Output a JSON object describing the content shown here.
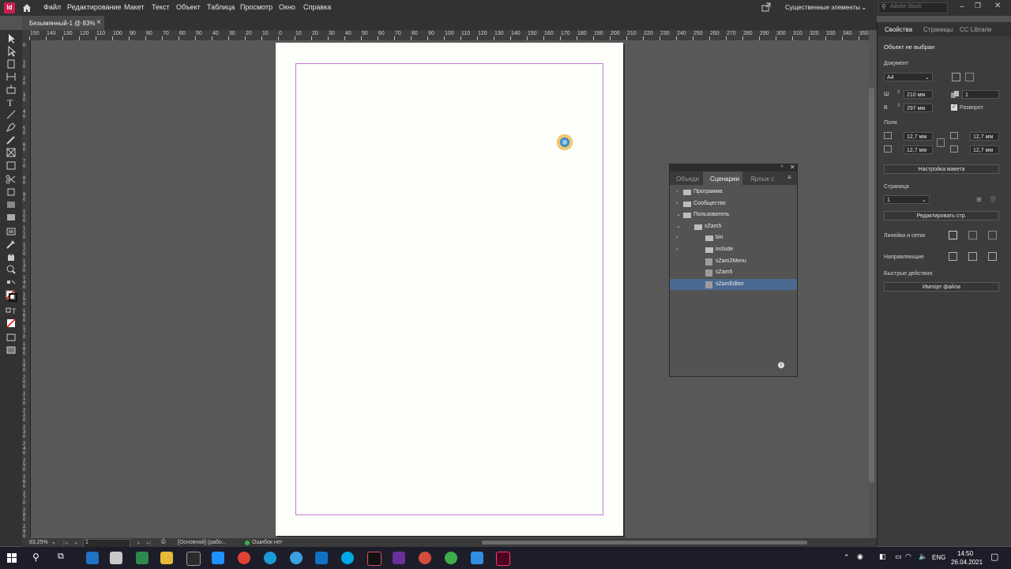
{
  "app": {
    "icon_text": "Id",
    "brand_color": "#cc1f4f"
  },
  "menubar": {
    "items": [
      "Файл",
      "Редактирование",
      "Макет",
      "Текст",
      "Объект",
      "Таблица",
      "Просмотр",
      "Окно",
      "Справка"
    ],
    "workspace": "Существенные элементы",
    "search_placeholder": "Adobe Stock"
  },
  "document_tab": {
    "title": "Безымянный-1 @ 83%",
    "close": "×"
  },
  "ruler": {
    "h_labels": [
      "150",
      "140",
      "130",
      "120",
      "110",
      "100",
      "90",
      "80",
      "70",
      "60",
      "50",
      "40",
      "30",
      "20",
      "10",
      "0",
      "10",
      "20",
      "30",
      "40",
      "50",
      "60",
      "70",
      "80",
      "90",
      "100",
      "110",
      "120",
      "130",
      "140",
      "150",
      "160",
      "170",
      "180",
      "190",
      "200",
      "210",
      "220",
      "230",
      "240",
      "250",
      "260",
      "270",
      "280",
      "290",
      "300",
      "310",
      "320",
      "330",
      "340",
      "350"
    ],
    "v_labels": [
      "0",
      "10",
      "20",
      "30",
      "40",
      "50",
      "60",
      "70",
      "80",
      "90",
      "100",
      "110",
      "120",
      "130",
      "140",
      "150",
      "160",
      "170",
      "180",
      "190",
      "200",
      "210",
      "220",
      "230",
      "240",
      "250",
      "260",
      "270",
      "280",
      "290"
    ]
  },
  "properties": {
    "tabs": [
      "Свойства",
      "Страницы",
      "CC Librarie"
    ],
    "no_selection": "Объект не выбран",
    "document_label": "Документ",
    "preset": "A4",
    "width_label": "Ш",
    "width": "210 мм",
    "height_label": "В",
    "height": "297 мм",
    "pages_count": "1",
    "spread_label": "Разворот",
    "margins_label": "Поля",
    "margin_top": "12,7 мм",
    "margin_bottom": "12,7 мм",
    "margin_left": "12,7 мм",
    "margin_right": "12,7 мм",
    "layout_button": "Настройка макета",
    "page_label": "Страница",
    "page_value": "1",
    "edit_page_button": "Редактировать стр.",
    "rulers_label": "Линейки и сетки",
    "guides_label": "Направляющие",
    "quick_actions_label": "Быстрые действия",
    "import_button": "Импорт файла"
  },
  "scripts_panel": {
    "tabs": [
      "Объеди",
      "Сценарии",
      "Ярлык с"
    ],
    "rows": [
      {
        "label": "Программа",
        "kind": "folder",
        "depth": 0,
        "chevron": "›"
      },
      {
        "label": "Сообщество",
        "kind": "folder",
        "depth": 0,
        "chevron": "›"
      },
      {
        "label": "Пользователь",
        "kind": "folder",
        "depth": 0,
        "chevron": "⌄"
      },
      {
        "label": "sZam5",
        "kind": "folder",
        "depth": 1,
        "chevron": "⌄"
      },
      {
        "label": "bin",
        "kind": "folder",
        "depth": 2,
        "chevron": "›"
      },
      {
        "label": "include",
        "kind": "folder",
        "depth": 2,
        "chevron": "›"
      },
      {
        "label": "sZam2Menu",
        "kind": "script",
        "depth": 2,
        "chevron": ""
      },
      {
        "label": "sZam5",
        "kind": "script",
        "depth": 2,
        "chevron": ""
      },
      {
        "label": "sZamEditor",
        "kind": "script",
        "depth": 2,
        "chevron": "",
        "selected": true
      }
    ],
    "selected_color": "#4b6a91"
  },
  "statusbar": {
    "zoom": "83,25%",
    "page": "1",
    "master": "[Основной] (рабо...",
    "preflight": "Ошибок нет",
    "preflight_color": "#39b54a"
  },
  "taskbar": {
    "lang": "ENG",
    "time": "14:50",
    "date": "26.04.2021"
  }
}
